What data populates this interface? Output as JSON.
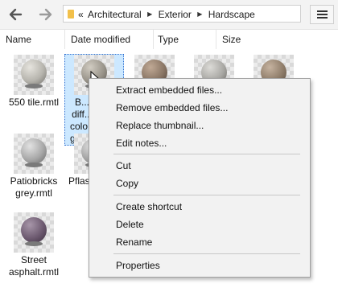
{
  "toolbar": {
    "back_icon": "arrow-left-icon",
    "forward_icon": "arrow-right-icon",
    "breadcrumb": [
      "«",
      "Architectural",
      "Exterior",
      "Hardscape"
    ],
    "menu_icon": "hamburger-menu-icon"
  },
  "columns": [
    "Name",
    "Date modified",
    "Type",
    "Size"
  ],
  "files": [
    {
      "label": "550 tile.rmtl",
      "ball": "#b7b5ae"
    },
    {
      "label": "B... diff... colo... gras...",
      "ball": "#9a958b",
      "selected": true
    },
    {
      "label": "",
      "ball": "#8a7665"
    },
    {
      "label": "",
      "ball": "#a9a8a4"
    },
    {
      "label": "",
      "ball": "#8f7d6a"
    },
    {
      "label": "Patiobricks grey.rmtl",
      "ball": "#a8a8a8"
    },
    {
      "label": "Pflas",
      "ball": "#a3a3a3"
    },
    {
      "label": "Street asphalt.rmtl",
      "ball": "#6d5a70"
    }
  ],
  "context_menu": {
    "items": [
      "Extract embedded files...",
      "Remove embedded files...",
      "Replace thumbnail...",
      "Edit notes...",
      "Cut",
      "Copy",
      "Create shortcut",
      "Delete",
      "Rename",
      "Properties"
    ]
  }
}
